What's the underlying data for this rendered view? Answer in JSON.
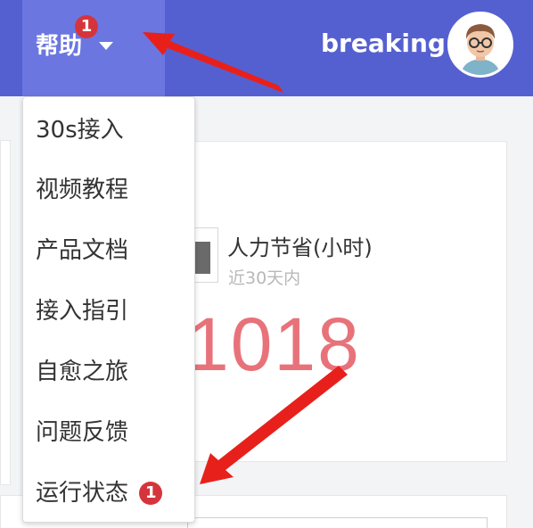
{
  "header": {
    "help_label": "帮助",
    "help_badge": "1",
    "username": "breaking",
    "avatar_icon": "user-avatar-icon",
    "caret_icon": "caret-down-icon"
  },
  "dropdown": {
    "items": [
      {
        "label": "30s接入"
      },
      {
        "label": "视频教程"
      },
      {
        "label": "产品文档"
      },
      {
        "label": "接入指引"
      },
      {
        "label": "自愈之旅"
      },
      {
        "label": "问题反馈"
      },
      {
        "label": "运行状态",
        "badge": "1"
      }
    ]
  },
  "stat": {
    "title": "人力节省(小时)",
    "subtitle": "近30天内",
    "value": "1018"
  },
  "colors": {
    "header_bg": "#5560d0",
    "header_active_bg": "#6b76e0",
    "badge": "#d6343c",
    "stat_value": "#e8727a",
    "arrow": "#e8201c"
  }
}
